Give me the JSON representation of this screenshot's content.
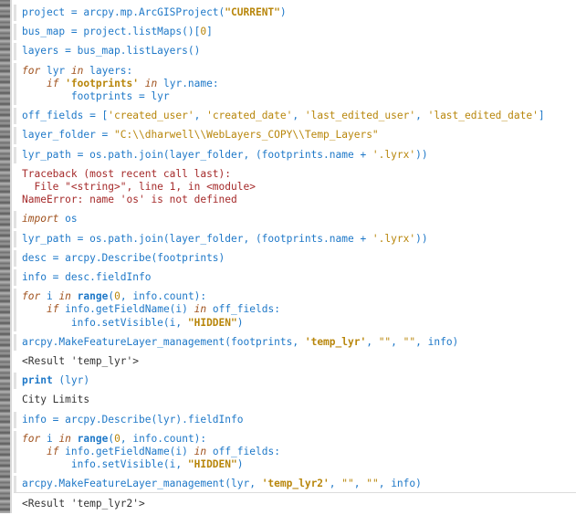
{
  "console": {
    "entries": [
      {
        "type": "input",
        "lines": [
          [
            [
              "blue",
              "project = arcpy.mp.ArcGISProject("
            ],
            [
              "strb",
              "\"CURRENT\""
            ],
            [
              "blue",
              ")"
            ]
          ]
        ]
      },
      {
        "type": "input",
        "lines": [
          [
            [
              "blue",
              "bus_map = project.listMaps()["
            ],
            [
              "num",
              "0"
            ],
            [
              "blue",
              "]"
            ]
          ]
        ]
      },
      {
        "type": "input",
        "lines": [
          [
            [
              "blue",
              "layers = bus_map.listLayers()"
            ]
          ]
        ]
      },
      {
        "type": "input",
        "lines": [
          [
            [
              "kw",
              "for"
            ],
            [
              "blue",
              " lyr "
            ],
            [
              "kw",
              "in"
            ],
            [
              "blue",
              " layers:"
            ]
          ],
          [
            [
              "blue",
              "    "
            ],
            [
              "kw",
              "if"
            ],
            [
              "blue",
              " "
            ],
            [
              "strb",
              "'footprints'"
            ],
            [
              "blue",
              " "
            ],
            [
              "kw",
              "in"
            ],
            [
              "blue",
              " lyr.name:"
            ]
          ],
          [
            [
              "blue",
              "        footprints = lyr"
            ]
          ]
        ]
      },
      {
        "type": "input",
        "lines": [
          [
            [
              "blue",
              "off_fields = ["
            ],
            [
              "str",
              "'created_user'"
            ],
            [
              "blue",
              ", "
            ],
            [
              "str",
              "'created_date'"
            ],
            [
              "blue",
              ", "
            ],
            [
              "str",
              "'last_edited_user'"
            ],
            [
              "blue",
              ", "
            ],
            [
              "str",
              "'last_edited_date'"
            ],
            [
              "blue",
              "]"
            ]
          ]
        ]
      },
      {
        "type": "input",
        "lines": [
          [
            [
              "blue",
              "layer_folder = "
            ],
            [
              "str",
              "\"C:\\\\dharwell\\\\WebLayers_COPY\\\\Temp_Layers\""
            ]
          ]
        ]
      },
      {
        "type": "input",
        "lines": [
          [
            [
              "blue",
              "lyr_path = os.path.join(layer_folder, (footprints.name + "
            ],
            [
              "str",
              "'.lyrx'"
            ],
            [
              "blue",
              "))"
            ]
          ]
        ]
      },
      {
        "type": "error",
        "lines": [
          [
            [
              "err",
              "Traceback (most recent call last):"
            ]
          ],
          [
            [
              "err",
              "  File \"<string>\", line 1, in <module>"
            ]
          ],
          [
            [
              "err",
              "NameError: name 'os' is not defined"
            ]
          ]
        ]
      },
      {
        "type": "input",
        "lines": [
          [
            [
              "kw",
              "import"
            ],
            [
              "blue",
              " os"
            ]
          ]
        ]
      },
      {
        "type": "input",
        "lines": [
          [
            [
              "blue",
              "lyr_path = os.path.join(layer_folder, (footprints.name + "
            ],
            [
              "str",
              "'.lyrx'"
            ],
            [
              "blue",
              "))"
            ]
          ]
        ]
      },
      {
        "type": "input",
        "lines": [
          [
            [
              "blue",
              "desc = arcpy.Describe(footprints)"
            ]
          ]
        ]
      },
      {
        "type": "input",
        "lines": [
          [
            [
              "blue",
              "info = desc.fieldInfo"
            ]
          ]
        ]
      },
      {
        "type": "input",
        "lines": [
          [
            [
              "kw",
              "for"
            ],
            [
              "blue",
              " i "
            ],
            [
              "kw",
              "in"
            ],
            [
              "blue",
              " "
            ],
            [
              "kwb",
              "range"
            ],
            [
              "blue",
              "("
            ],
            [
              "num",
              "0"
            ],
            [
              "blue",
              ", info.count):"
            ]
          ],
          [
            [
              "blue",
              "    "
            ],
            [
              "kw",
              "if"
            ],
            [
              "blue",
              " info.getFieldName(i) "
            ],
            [
              "kw",
              "in"
            ],
            [
              "blue",
              " off_fields:"
            ]
          ],
          [
            [
              "blue",
              "        info.setVisible(i, "
            ],
            [
              "strb",
              "\"HIDDEN\""
            ],
            [
              "blue",
              ")"
            ]
          ]
        ]
      },
      {
        "type": "input",
        "lines": [
          [
            [
              "blue",
              "arcpy.MakeFeatureLayer_management(footprints, "
            ],
            [
              "strb",
              "'temp_lyr'"
            ],
            [
              "blue",
              ", "
            ],
            [
              "str",
              "\"\""
            ],
            [
              "blue",
              ", "
            ],
            [
              "str",
              "\"\""
            ],
            [
              "blue",
              ", info)"
            ]
          ]
        ]
      },
      {
        "type": "output",
        "lines": [
          [
            [
              "plain",
              "<Result 'temp_lyr'>"
            ]
          ]
        ]
      },
      {
        "type": "input",
        "lines": [
          [
            [
              "kwb",
              "print"
            ],
            [
              "blue",
              " (lyr)"
            ]
          ]
        ]
      },
      {
        "type": "output",
        "lines": [
          [
            [
              "plain",
              "City Limits"
            ]
          ]
        ]
      },
      {
        "type": "input",
        "lines": [
          [
            [
              "blue",
              "info = arcpy.Describe(lyr).fieldInfo"
            ]
          ]
        ]
      },
      {
        "type": "input",
        "lines": [
          [
            [
              "kw",
              "for"
            ],
            [
              "blue",
              " i "
            ],
            [
              "kw",
              "in"
            ],
            [
              "blue",
              " "
            ],
            [
              "kwb",
              "range"
            ],
            [
              "blue",
              "("
            ],
            [
              "num",
              "0"
            ],
            [
              "blue",
              ", info.count):"
            ]
          ],
          [
            [
              "blue",
              "    "
            ],
            [
              "kw",
              "if"
            ],
            [
              "blue",
              " info.getFieldName(i) "
            ],
            [
              "kw",
              "in"
            ],
            [
              "blue",
              " off_fields:"
            ]
          ],
          [
            [
              "blue",
              "        info.setVisible(i, "
            ],
            [
              "strb",
              "\"HIDDEN\""
            ],
            [
              "blue",
              ")"
            ]
          ]
        ]
      },
      {
        "type": "input",
        "lines": [
          [
            [
              "blue",
              "arcpy.MakeFeatureLayer_management(lyr, "
            ],
            [
              "strb",
              "'temp_lyr2'"
            ],
            [
              "blue",
              ", "
            ],
            [
              "str",
              "\"\""
            ],
            [
              "blue",
              ", "
            ],
            [
              "str",
              "\"\""
            ],
            [
              "blue",
              ", info)"
            ]
          ]
        ]
      },
      {
        "type": "output",
        "lines": [
          [
            [
              "plain",
              "<Result 'temp_lyr2'>"
            ]
          ]
        ]
      }
    ]
  },
  "colors": {
    "identifier": "#1e78c8",
    "string": "#b8860b",
    "keyword": "#a0521e",
    "error": "#a52a2a",
    "output": "#333333"
  }
}
